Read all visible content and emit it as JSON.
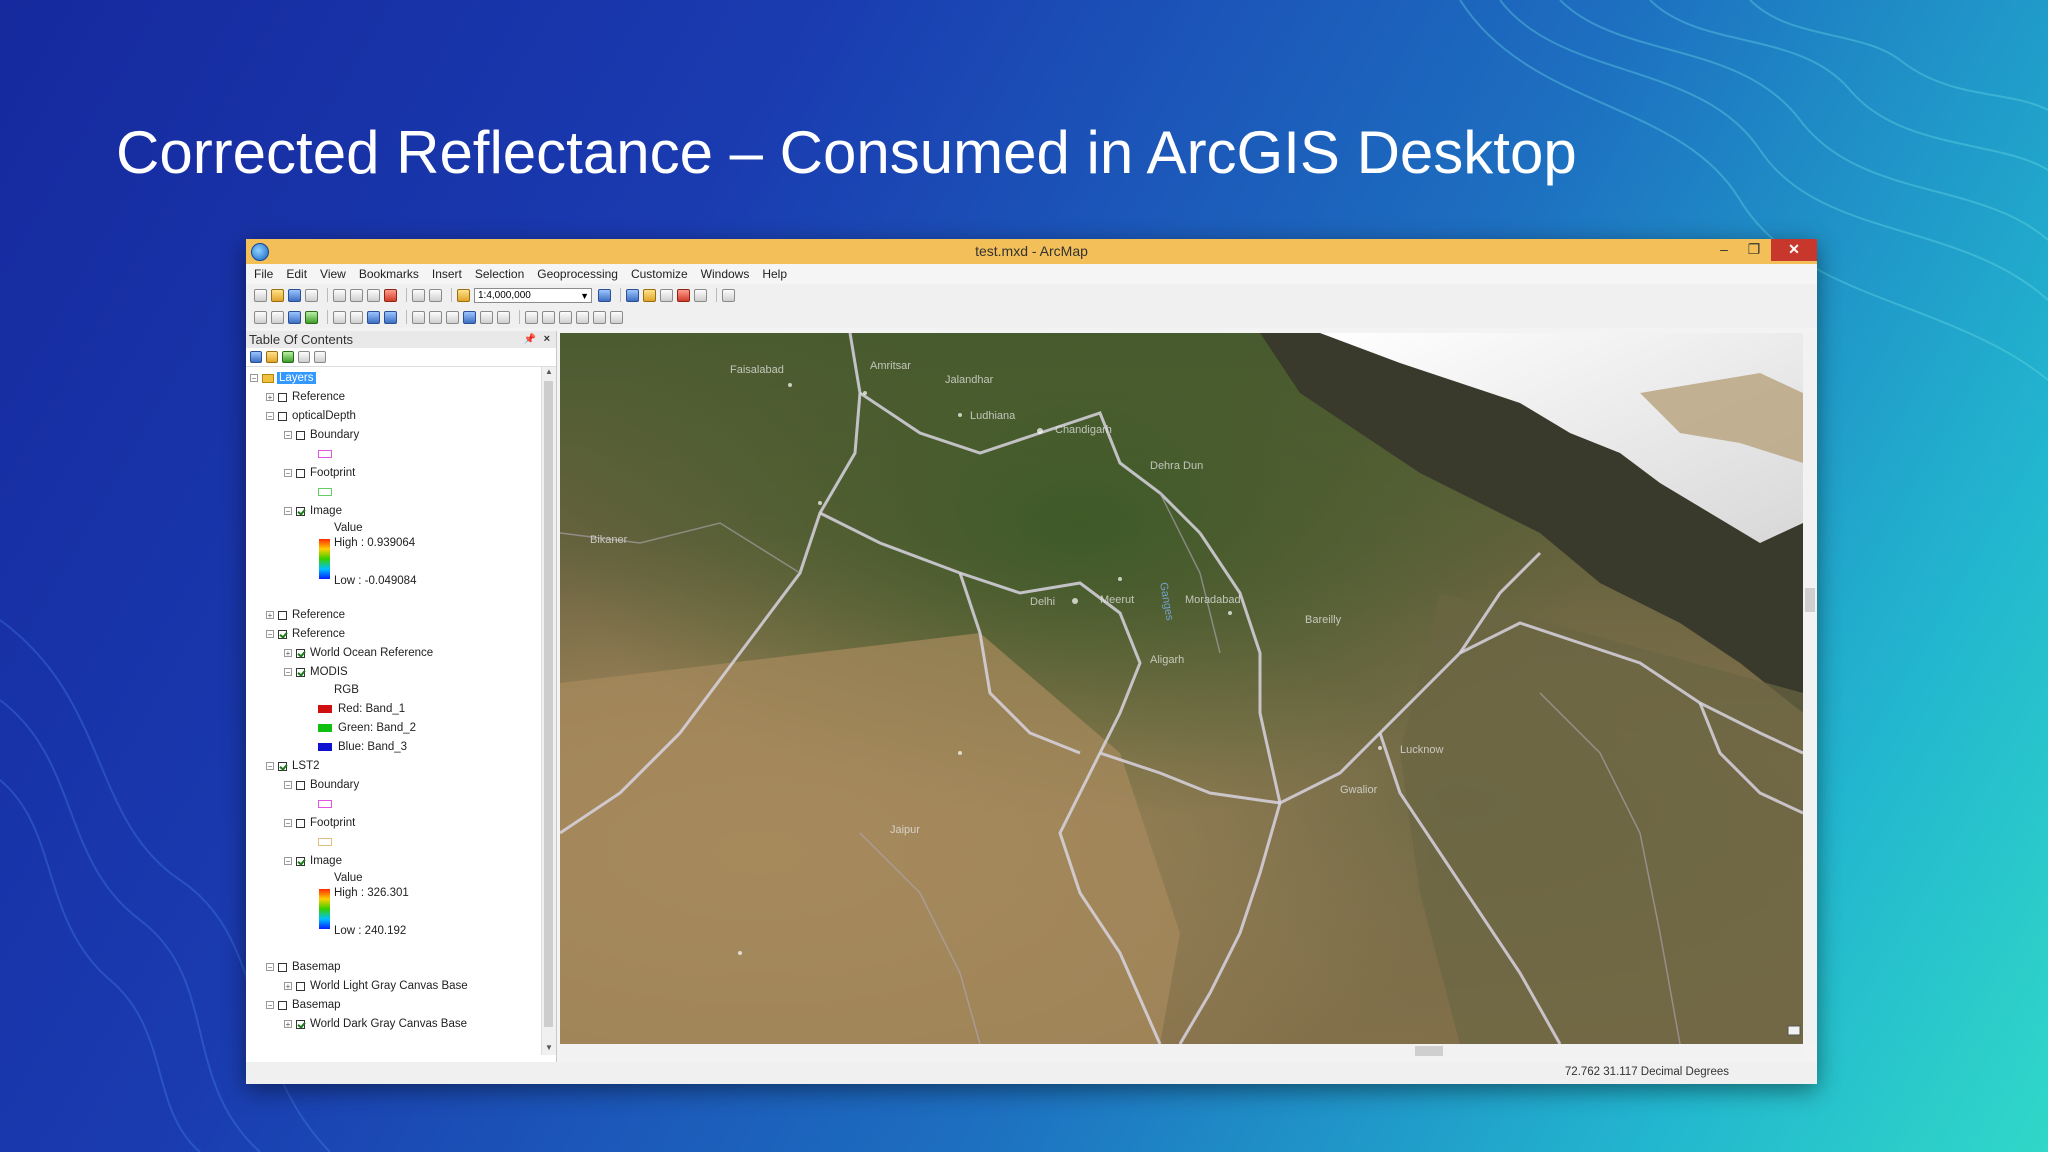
{
  "slide": {
    "title": "Corrected Reflectance – Consumed in ArcGIS Desktop"
  },
  "window": {
    "title": "test.mxd - ArcMap",
    "minimize": "–",
    "maximize": "❐",
    "close": "✕"
  },
  "menu": [
    "File",
    "Edit",
    "View",
    "Bookmarks",
    "Insert",
    "Selection",
    "Geoprocessing",
    "Customize",
    "Windows",
    "Help"
  ],
  "toolbar": {
    "scale": "1:4,000,000"
  },
  "toc": {
    "title": "Table Of Contents",
    "layers_label": "Layers",
    "rows": {
      "r1": "Reference",
      "r2": "opticalDepth",
      "r3": "Boundary",
      "r4": "Footprint",
      "r5": "Image",
      "r6": "Value",
      "r7": "High : 0.939064",
      "r8": "Low : -0.049084",
      "r9": "Reference",
      "r10": "Reference",
      "r11": "World Ocean Reference",
      "r12": "MODIS",
      "r13": "RGB",
      "r14": "Red:   Band_1",
      "r15": "Green: Band_2",
      "r16": "Blue:   Band_3",
      "r17": "LST2",
      "r18": "Boundary",
      "r19": "Footprint",
      "r20": "Image",
      "r21": "Value",
      "r22": "High : 326.301",
      "r23": "Low : 240.192",
      "r24": "Basemap",
      "r25": "World Light Gray Canvas Base",
      "r26": "Basemap",
      "r27": "World Dark Gray Canvas Base"
    }
  },
  "map": {
    "labels": [
      "Faisalabad",
      "Amritsar",
      "Jalandhar",
      "Ludhiana",
      "Chandigarh",
      "Dehra Dun",
      "Meerut",
      "Moradabad",
      "Ganges",
      "Bareilly",
      "Delhi",
      "Jaipur",
      "Lucknow",
      "Gwalior",
      "Aligarh",
      "Bikaner"
    ]
  },
  "status": {
    "coords": "72.762  31.117 Decimal Degrees"
  },
  "colors": {
    "red_band": "#d01010",
    "green_band": "#10c010",
    "blue_band": "#1010d0"
  }
}
